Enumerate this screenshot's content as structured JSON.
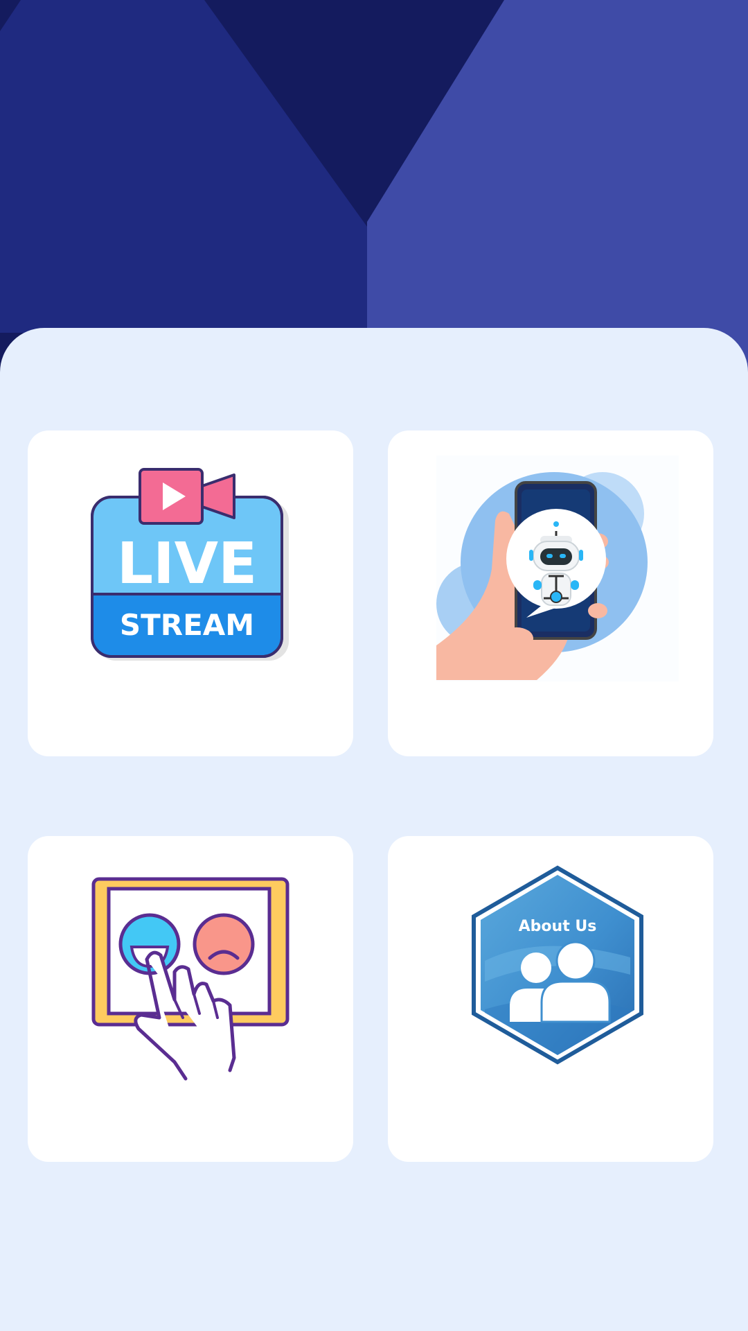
{
  "colors": {
    "header_dark": "#141b5e",
    "header_mid": "#1f2a80",
    "header_light": "#3f4ba7",
    "panel_bg": "#e6effd",
    "card_bg": "#ffffff"
  },
  "cards": [
    {
      "id": "live-stream",
      "icon": "live-stream-icon",
      "badge_top": "LIVE",
      "badge_bottom": "STREAM"
    },
    {
      "id": "chatbot",
      "icon": "chatbot-phone-icon"
    },
    {
      "id": "feedback",
      "icon": "feedback-rating-icon"
    },
    {
      "id": "about-us",
      "icon": "about-us-hexagon-icon",
      "label": "About Us"
    }
  ]
}
